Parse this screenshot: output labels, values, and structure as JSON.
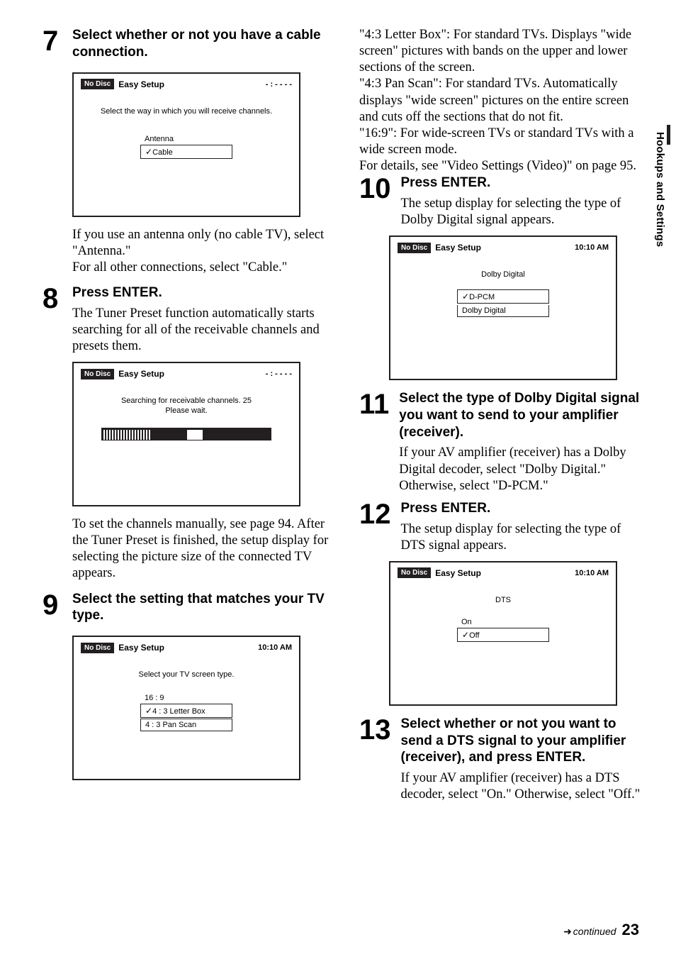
{
  "sidebar_label": "Hookups and Settings",
  "continued": "continued",
  "page_num": "23",
  "common": {
    "no_disc": "No Disc",
    "easy_setup": "Easy Setup",
    "clock_dashes": "- : - -  - -",
    "clock_time": "10:10 AM",
    "check": "✓"
  },
  "left": {
    "s7": {
      "num": "7",
      "title": "Select whether or not you have a cable connection.",
      "fig_label": "Select the way in which you will receive channels.",
      "opt1": "Antenna",
      "opt2": "Cable",
      "p1": "If you use an antenna only (no cable TV), select \"Antenna.\"",
      "p2": "For all other connections, select \"Cable.\""
    },
    "s8": {
      "num": "8",
      "title": "Press ENTER.",
      "p1": "The Tuner Preset function automatically starts searching for all of the receivable channels and presets them.",
      "fig_label": "Searching for receivable channels.  25\nPlease wait.",
      "p2": "To set the channels manually, see page 94. After the Tuner Preset is finished, the setup display for selecting the picture size of the connected TV appears."
    },
    "s9": {
      "num": "9",
      "title": "Select the setting that matches your TV type.",
      "fig_label": "Select your TV screen type.",
      "opt1": "16 : 9",
      "opt2": "4 : 3  Letter Box",
      "opt3": "4 : 3  Pan Scan"
    }
  },
  "right": {
    "intro": "\"4:3 Letter Box\": For standard TVs. Displays \"wide screen\" pictures with bands on the upper and lower sections of the screen.\n\"4:3 Pan Scan\": For standard TVs. Automatically displays \"wide screen\" pictures on the entire screen and cuts off the sections that do not fit.\n\"16:9\": For wide-screen TVs or standard TVs with a wide screen mode.\nFor details, see \"Video Settings (Video)\" on page 95.",
    "s10": {
      "num": "10",
      "title": "Press ENTER.",
      "p1": "The setup display for selecting the type of Dolby Digital signal appears.",
      "fig_label": "Dolby Digital",
      "opt1": "D-PCM",
      "opt2": "Dolby Digital"
    },
    "s11": {
      "num": "11",
      "title": "Select the type of Dolby Digital signal you want to send to your amplifier (receiver).",
      "p1": "If your AV amplifier (receiver) has a Dolby Digital decoder, select \"Dolby Digital.\" Otherwise, select \"D-PCM.\""
    },
    "s12": {
      "num": "12",
      "title": "Press ENTER.",
      "p1": "The setup display for selecting the type of DTS signal appears.",
      "fig_label": "DTS",
      "opt1": "On",
      "opt2": "Off"
    },
    "s13": {
      "num": "13",
      "title": "Select whether or not you want to send a DTS signal to your amplifier (receiver), and press ENTER.",
      "p1": "If your AV amplifier (receiver) has a DTS decoder, select \"On.\" Otherwise, select \"Off.\""
    }
  }
}
